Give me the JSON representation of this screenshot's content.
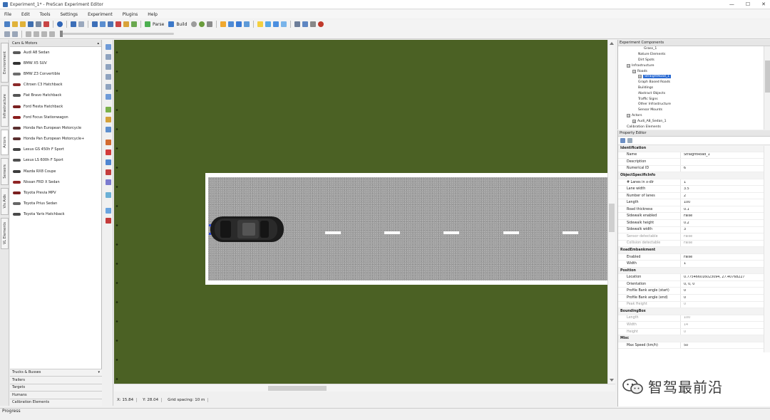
{
  "window": {
    "title": "Experiment_1* - PreScan Experiment Editor",
    "controls": [
      "—",
      "☐",
      "✕"
    ]
  },
  "menu": [
    "File",
    "Edit",
    "Tools",
    "Settings",
    "Experiment",
    "Plugins",
    "Help"
  ],
  "toolbar": {
    "parse_label": "Parse",
    "build_label": "Build"
  },
  "left_tabs": [
    "Environment",
    "Infrastructure",
    "Actors",
    "Sensors",
    "Vis Aids",
    "VL Elements"
  ],
  "library": {
    "header": "Cars & Motors",
    "items": [
      "Audi A8 Sedan",
      "BMW X5 SUV",
      "BMW Z3 Convertible",
      "Citroen C3 Hatchback",
      "Fiat Bravo Hatchback",
      "Ford Fiesta Hatchback",
      "Ford Focus Stationwagon",
      "Honda Pan European Motorcycle",
      "Honda Pan European Motorcycle+",
      "Lexus GS 450h F Sport",
      "Lexus LS 600h F Sport",
      "Mazda RX8 Coupe",
      "Nissan FRD X Sedan",
      "Toyota Previa MPV",
      "Toyota Prius Sedan",
      "Toyota Yaris Hatchback"
    ],
    "bottom_categories": [
      "Trucks & Busses",
      "Trailers",
      "Targets",
      "Humans",
      "Calibration Elements"
    ]
  },
  "status": {
    "x": "X: 15.84",
    "y": "Y: 28.04",
    "grid": "Grid spacing: 10 m",
    "progress": "Progress"
  },
  "components": {
    "title": "Experiment Components",
    "tree": [
      {
        "indent": 4,
        "exp": "",
        "label": "Grass_1"
      },
      {
        "indent": 3,
        "exp": "",
        "label": "Nature Elements"
      },
      {
        "indent": 3,
        "exp": "",
        "label": "Dirt Spots"
      },
      {
        "indent": 1,
        "exp": "⊟",
        "label": "Infrastructure"
      },
      {
        "indent": 2,
        "exp": "⊟",
        "label": "Roads"
      },
      {
        "indent": 3,
        "exp": "⊞",
        "label": "StraightRoad_1",
        "selected": true
      },
      {
        "indent": 3,
        "exp": "",
        "label": "Graph Based Roads"
      },
      {
        "indent": 3,
        "exp": "",
        "label": "Buildings"
      },
      {
        "indent": 3,
        "exp": "",
        "label": "Abstract Objects"
      },
      {
        "indent": 3,
        "exp": "",
        "label": "Traffic Signs"
      },
      {
        "indent": 3,
        "exp": "",
        "label": "Other Infrastructure"
      },
      {
        "indent": 3,
        "exp": "",
        "label": "Sensor Mounts"
      },
      {
        "indent": 1,
        "exp": "⊟",
        "label": "Actors"
      },
      {
        "indent": 2,
        "exp": "⊞",
        "label": "Audi_A8_Sedan_1"
      },
      {
        "indent": 1,
        "exp": "",
        "label": "Calibration Elements"
      }
    ]
  },
  "properties": {
    "title": "Property Editor",
    "rows": [
      {
        "cat": true,
        "name": "Identification"
      },
      {
        "name": "Name",
        "value": "StraightRoad_1"
      },
      {
        "name": "Description",
        "value": ""
      },
      {
        "name": "Numerical ID",
        "value": "6"
      },
      {
        "cat": true,
        "name": "ObjectSpecificInfo"
      },
      {
        "name": "# Lanes in x-dir",
        "value": "1"
      },
      {
        "name": "Lane width",
        "value": "3.5"
      },
      {
        "name": "Number of lanes",
        "value": "2"
      },
      {
        "name": "Length",
        "value": "100"
      },
      {
        "name": "Road thickness",
        "value": "0.1"
      },
      {
        "name": "Sidewalk enabled",
        "value": "False"
      },
      {
        "name": "Sidewalk height",
        "value": "0.2"
      },
      {
        "name": "Sidewalk width",
        "value": "3"
      },
      {
        "name": "Sensor detectable",
        "value": "False",
        "dim": true
      },
      {
        "name": "Collision detectable",
        "value": "False",
        "dim": true
      },
      {
        "cat": true,
        "name": "RoadEmbankment"
      },
      {
        "name": "Enabled",
        "value": "False"
      },
      {
        "name": "Width",
        "value": "1"
      },
      {
        "cat": true,
        "name": "Position"
      },
      {
        "name": "Location",
        "value": "0.775466016023094, 27.40768227"
      },
      {
        "name": "Orientation",
        "value": "0, 0, 0"
      },
      {
        "name": "Profile Bank angle (start)",
        "value": "0"
      },
      {
        "name": "Profile Bank angle (end)",
        "value": "0"
      },
      {
        "name": "Peak Height",
        "value": "0",
        "dim": true
      },
      {
        "cat": true,
        "name": "BoundingBox"
      },
      {
        "name": "Length",
        "value": "100",
        "dim": true
      },
      {
        "name": "Width",
        "value": "14",
        "dim": true
      },
      {
        "name": "Height",
        "value": "0",
        "dim": true
      },
      {
        "cat": true,
        "name": "Misc"
      },
      {
        "name": "Max Speed (km/h)",
        "value": "50"
      }
    ]
  },
  "watermark": "智驾最前沿",
  "colors": {
    "grass": "#4b6124",
    "asphalt": "#9f9f9f",
    "selection": "#2a6ad2"
  }
}
